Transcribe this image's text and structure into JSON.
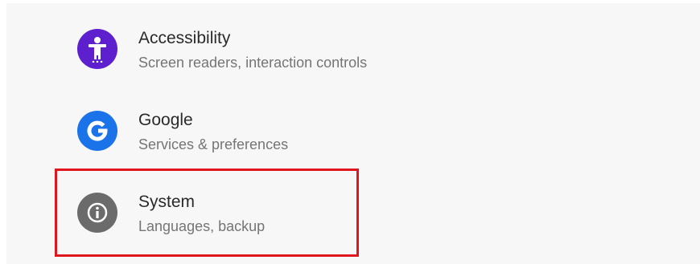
{
  "settings": {
    "items": [
      {
        "title": "Accessibility",
        "subtitle": "Screen readers, interaction controls",
        "icon": "accessibility-icon",
        "icon_bg": "#5e1fcf"
      },
      {
        "title": "Google",
        "subtitle": "Services & preferences",
        "icon": "google-icon",
        "icon_bg": "#1a73e8"
      },
      {
        "title": "System",
        "subtitle": "Languages, backup",
        "icon": "info-icon",
        "icon_bg": "#6b6b6b"
      }
    ]
  },
  "highlight": {
    "color": "#e0161e",
    "target": "System"
  }
}
